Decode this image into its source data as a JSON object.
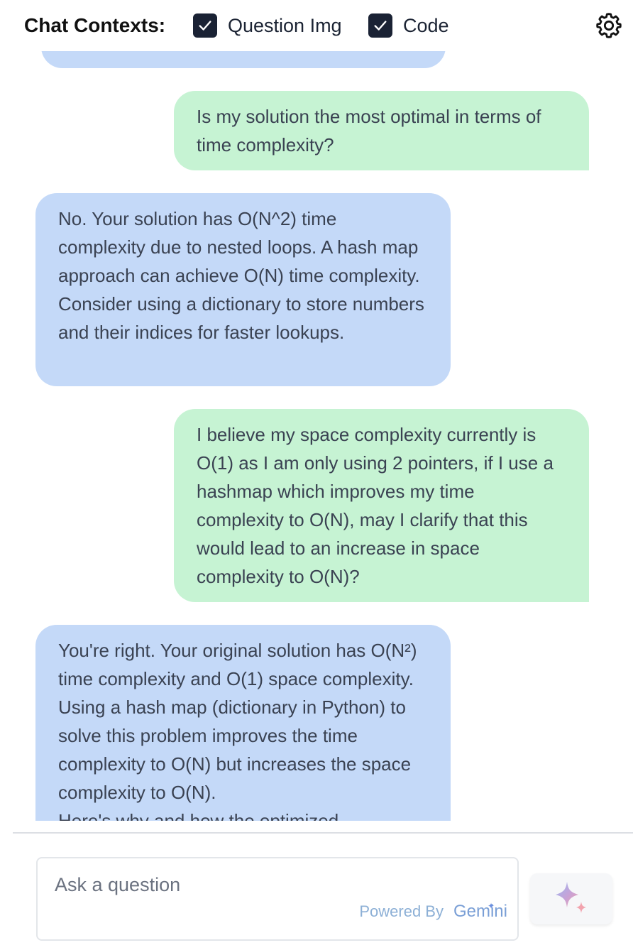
{
  "header": {
    "title": "Chat Contexts:",
    "contexts": [
      {
        "label": "Question Img",
        "checked": true
      },
      {
        "label": "Code",
        "checked": true
      }
    ],
    "settings_icon": "gear-icon"
  },
  "messages": [
    {
      "role": "user",
      "text": "Is my solution the most optimal in terms of time complexity?"
    },
    {
      "role": "assistant",
      "text": "No. Your solution has O(N^2) time complexity due to nested loops. A hash map approach can achieve O(N) time complexity. Consider using a dictionary to store numbers and their indices for faster lookups."
    },
    {
      "role": "user",
      "text": "I believe my space complexity currently is O(1) as I am only using 2 pointers, if I use a hashmap which improves my time complexity to O(N), may I clarify that this would lead to an increase in space complexity to O(N)?"
    },
    {
      "role": "assistant",
      "text": "You're right. Your original solution has O(N²) time complexity and O(1) space complexity. Using a hash map (dictionary in Python) to solve this problem improves the time complexity to O(N) but increases the space complexity to O(N).\nHere's why and how the optimized"
    }
  ],
  "composer": {
    "placeholder": "Ask a question",
    "powered_by": "Powered By",
    "brand": "Gemini",
    "send_icon": "sparkle-icon"
  },
  "colors": {
    "user_bubble": "#c6f3d3",
    "assistant_bubble": "#c4d9f8",
    "checkbox": "#1a2234"
  }
}
